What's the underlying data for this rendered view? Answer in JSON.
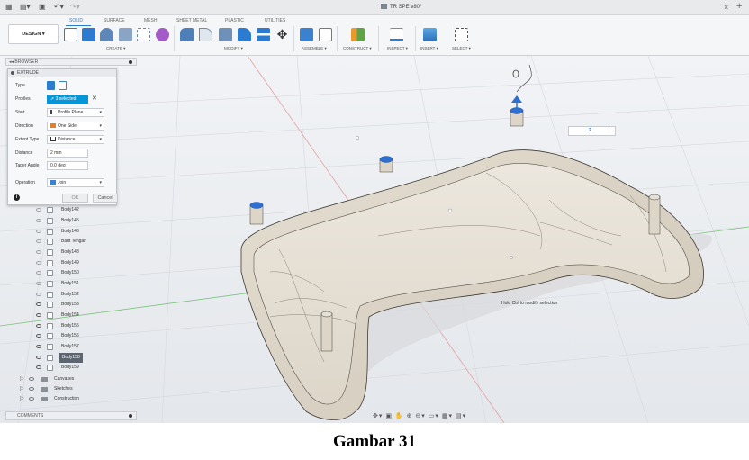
{
  "window": {
    "doc_title": "TR SPE v80*",
    "close_glyph": "×",
    "add_glyph": "+"
  },
  "toolbar": {
    "design_label": "DESIGN ▾",
    "tabs": [
      "SOLID",
      "SURFACE",
      "MESH",
      "SHEET METAL",
      "PLASTIC",
      "UTILITIES"
    ],
    "groups": [
      "CREATE ▾",
      "MODIFY ▾",
      "ASSEMBLE ▾",
      "CONSTRUCT ▾",
      "INSPECT ▾",
      "INSERT ▾",
      "SELECT ▾"
    ],
    "accent": "#2b7bd0"
  },
  "browser": {
    "header": "BROWSER"
  },
  "extrude": {
    "title": "EXTRUDE",
    "fields": {
      "type_label": "Type",
      "profiles_label": "Profiles",
      "profiles_value": "3 selected",
      "start_label": "Start",
      "start_value": "Profile Plane",
      "direction_label": "Direction",
      "direction_value": "One Side",
      "extent_label": "Extent Type",
      "extent_value": "Distance",
      "distance_label": "Distance",
      "distance_value": "2 mm",
      "taper_label": "Taper Angle",
      "taper_value": "0.0 deg",
      "operation_label": "Operation",
      "operation_value": "Join"
    },
    "ok_label": "OK",
    "cancel_label": "Cancel",
    "info_glyph": "i"
  },
  "tree": {
    "items": [
      "Body142",
      "Body145",
      "Body146",
      "Baut Tengah",
      "Body148",
      "Body149",
      "Body150",
      "Body151",
      "Body152",
      "Body153",
      "Body154",
      "Body155",
      "Body156",
      "Body157",
      "Body158",
      "Body159"
    ],
    "selected": "Body158",
    "folders": [
      "Canvases",
      "Sketches",
      "Construction"
    ]
  },
  "comments": {
    "label": "COMMENTS"
  },
  "viewport": {
    "hint": "Hold Ctrl to modify selection",
    "distance_input": "2"
  },
  "caption": "Gambar 31"
}
